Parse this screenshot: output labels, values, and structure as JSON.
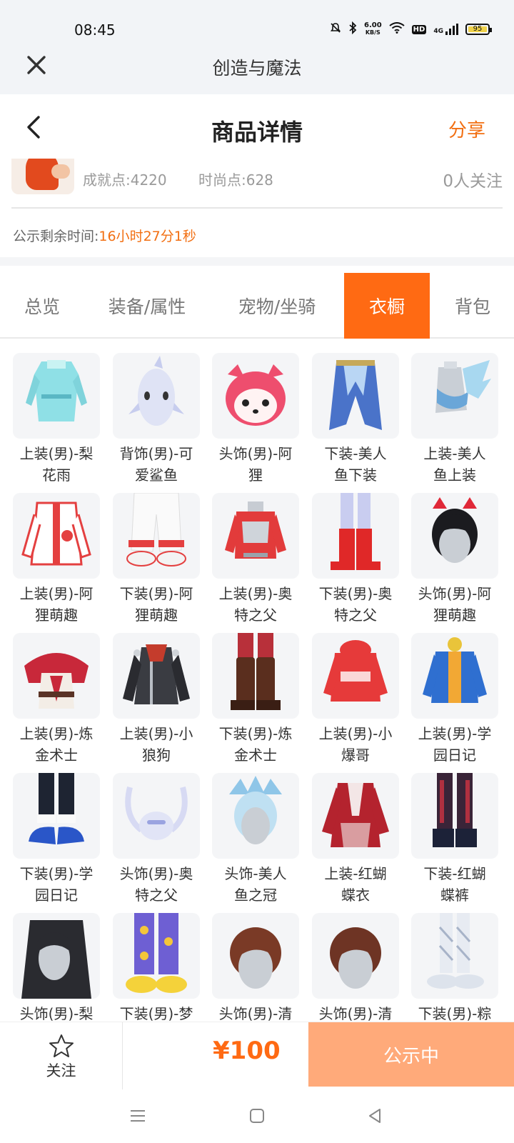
{
  "status_bar": {
    "time": "08:45",
    "net_speed_value": "6.00",
    "net_speed_unit": "KB/S",
    "hd": "HD",
    "network": "4G",
    "battery": "95"
  },
  "app_bar": {
    "title": "创造与魔法"
  },
  "header": {
    "title": "商品详情",
    "share": "分享"
  },
  "profile": {
    "achievement": "成就点:4220",
    "fashion": "时尚点:628",
    "followers": "0人关注"
  },
  "countdown": {
    "label": "公示剩余时间:",
    "value": "16小时27分1秒"
  },
  "tabs": [
    {
      "label": "总览",
      "active": false
    },
    {
      "label": "装备/属性",
      "active": false
    },
    {
      "label": "宠物/坐骑",
      "active": false
    },
    {
      "label": "衣橱",
      "active": true
    },
    {
      "label": "背包",
      "active": false
    }
  ],
  "items": [
    {
      "label": "上装(男)-梨\n花雨"
    },
    {
      "label": "背饰(男)-可\n爱鲨鱼"
    },
    {
      "label": "头饰(男)-阿\n狸"
    },
    {
      "label": "下装-美人\n鱼下装"
    },
    {
      "label": "上装-美人\n鱼上装"
    },
    {
      "label": "上装(男)-阿\n狸萌趣"
    },
    {
      "label": "下装(男)-阿\n狸萌趣"
    },
    {
      "label": "上装(男)-奥\n特之父"
    },
    {
      "label": "下装(男)-奥\n特之父"
    },
    {
      "label": "头饰(男)-阿\n狸萌趣"
    },
    {
      "label": "上装(男)-炼\n金术士"
    },
    {
      "label": "上装(男)-小\n狼狗"
    },
    {
      "label": "下装(男)-炼\n金术士"
    },
    {
      "label": "上装(男)-小\n爆哥"
    },
    {
      "label": "上装(男)-学\n园日记"
    },
    {
      "label": "下装(男)-学\n园日记"
    },
    {
      "label": "头饰(男)-奥\n特之父"
    },
    {
      "label": "头饰-美人\n鱼之冠"
    },
    {
      "label": "上装-红蝴\n蝶衣"
    },
    {
      "label": "下装-红蝴\n蝶裤"
    },
    {
      "label": "头饰(男)-梨"
    },
    {
      "label": "下装(男)-梦"
    },
    {
      "label": "头饰(男)-清"
    },
    {
      "label": "头饰(男)-清"
    },
    {
      "label": "下装(男)-粽"
    }
  ],
  "bottom": {
    "follow": "关注",
    "price": "¥100",
    "status": "公示中"
  },
  "colors": {
    "accent": "#ff6a13",
    "status_button": "#ffaa7a",
    "share": "#f26f12"
  }
}
